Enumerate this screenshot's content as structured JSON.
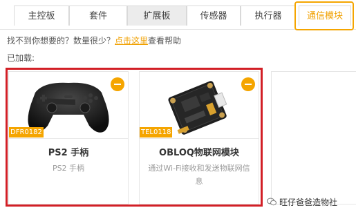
{
  "tabs": [
    {
      "label": "主控板"
    },
    {
      "label": "套件"
    },
    {
      "label": "扩展板",
      "state": "hover"
    },
    {
      "label": "传感器"
    },
    {
      "label": "执行器"
    },
    {
      "label": "通信模块",
      "state": "active"
    }
  ],
  "help": {
    "prefix": "找不到你想要的？数量很少？",
    "link": "点击这里",
    "suffix": "查看帮助"
  },
  "loaded_label": "已加载:",
  "cards": [
    {
      "code": "DFR0182",
      "title": "PS2 手柄",
      "desc": "PS2 手柄",
      "icon": "gamepad-icon"
    },
    {
      "code": "TEL0118",
      "title": "OBLOQ物联网模块",
      "desc": "通过Wi-Fi接收和发送物联网信息",
      "icon": "iot-module-icon"
    }
  ],
  "watermark": "旺仔爸爸造物社",
  "colors": {
    "accent": "#f5a500",
    "highlight": "#d21f26"
  }
}
